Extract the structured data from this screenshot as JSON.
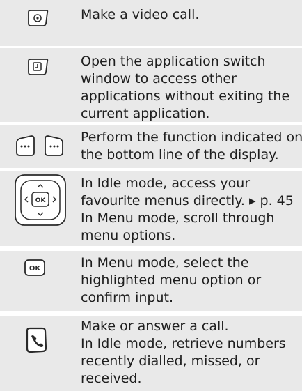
{
  "rows": [
    {
      "icon": "video-call-key-icon",
      "lines": [
        "Make a video call."
      ]
    },
    {
      "icon": "application-switch-key-icon",
      "lines": [
        "Open the application switch",
        "window to access other",
        "applications without exiting the",
        "current application."
      ]
    },
    {
      "icon": "soft-keys-icon",
      "lines": [
        "Perform the function indicated on",
        "the bottom line of the display."
      ]
    },
    {
      "icon": "navigation-keys-icon",
      "lines": [
        "In Idle mode, access your",
        "favourite menus directly. ▸ p. 45",
        "In Menu mode, scroll through",
        "menu options."
      ]
    },
    {
      "icon": "ok-key-icon",
      "ok_label": "OK",
      "lines": [
        "In Menu mode, select the",
        "highlighted menu option or",
        "confirm input."
      ]
    },
    {
      "icon": "dial-key-icon",
      "lines": [
        "Make or answer a call.",
        "In Idle mode, retrieve numbers",
        "recently dialled, missed, or",
        "received."
      ]
    }
  ],
  "colors": {
    "row_bg": "#e9e9e9",
    "text": "#1e1e1e",
    "icon_stroke": "#2a2a2a"
  }
}
